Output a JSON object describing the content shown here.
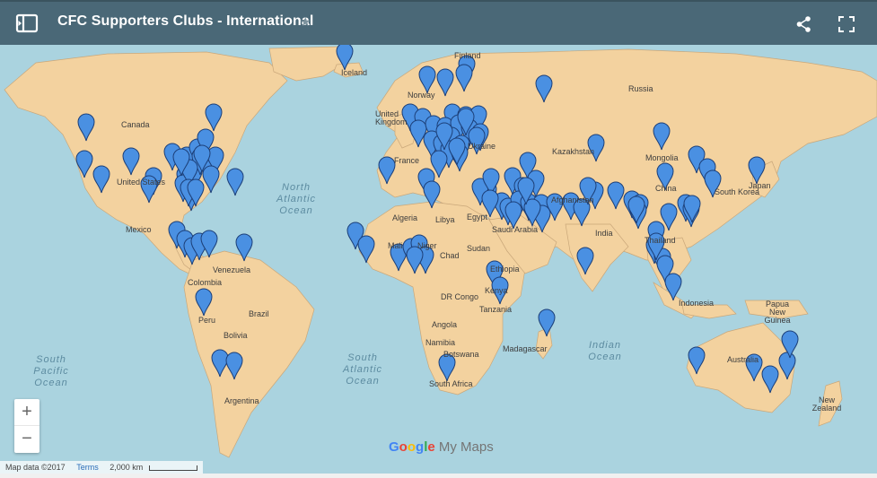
{
  "header": {
    "title": "CFC Supporters Clubs - International",
    "star_glyph": "★",
    "icons": [
      "sidebar-toggle-icon",
      "star-icon",
      "share-icon",
      "fullscreen-icon"
    ]
  },
  "map": {
    "colors": {
      "water": "#aad3df",
      "land": "#f3d29f",
      "border": "#c9a77a",
      "marker": "#4a90e2",
      "marker_stroke": "#1c3f78",
      "header": "#4a6877"
    },
    "labels": {
      "finland": "Finland",
      "iceland": "Iceland",
      "norway": "Norway",
      "russia": "Russia",
      "united_kingdom": "United Kingdom",
      "ukraine": "Ukraine",
      "france": "France",
      "kazakhstan": "Kazakhstan",
      "mongolia": "Mongolia",
      "canada": "Canada",
      "united_states": "United States",
      "mexico": "Mexico",
      "china": "China",
      "south_korea": "South Korea",
      "japan": "Japan",
      "algeria": "Algeria",
      "libya": "Libya",
      "egypt": "Egypt",
      "saudi_arabia": "Saudi Arabia",
      "afghanistan": "Afghanistan",
      "india": "India",
      "thailand": "Thailand",
      "mali": "Mali",
      "niger": "Niger",
      "chad": "Chad",
      "sudan": "Sudan",
      "ethiopia": "Ethiopia",
      "venezuela": "Venezuela",
      "colombia": "Colombia",
      "brazil": "Brazil",
      "peru": "Peru",
      "bolivia": "Bolivia",
      "argentina": "Argentina",
      "dr_congo": "DR Congo",
      "kenya": "Kenya",
      "tanzania": "Tanzania",
      "angola": "Angola",
      "namibia": "Namibia",
      "botswana": "Botswana",
      "madagascar": "Madagascar",
      "south_africa": "South Africa",
      "indonesia": "Indonesia",
      "papua_new_guinea": "Papua New Guinea",
      "australia": "Australia",
      "new_zealand": "New Zealand"
    },
    "oceans": {
      "north_atlantic": [
        "North",
        "Atlantic",
        "Ocean"
      ],
      "south_pacific": [
        "South",
        "Pacific",
        "Ocean"
      ],
      "south_atlantic": [
        "South",
        "Atlantic",
        "Ocean"
      ],
      "indian": [
        "Indian",
        "Ocean"
      ]
    },
    "marker_count": 128
  },
  "controls": {
    "zoom_in": "+",
    "zoom_out": "−"
  },
  "brand": {
    "google": "Google",
    "product": "My Maps"
  },
  "attribution": {
    "map_data": "Map data ©2017",
    "terms": "Terms",
    "scale": "2,000 km"
  }
}
